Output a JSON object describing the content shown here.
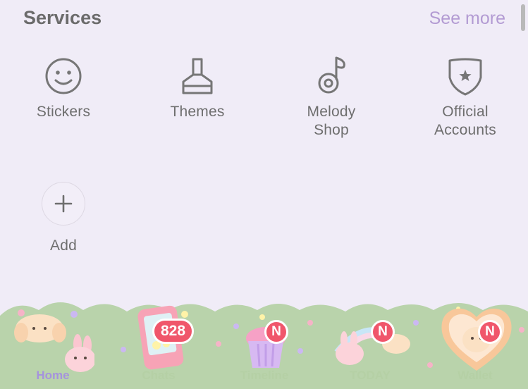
{
  "header": {
    "title": "Services",
    "see_more": "See more"
  },
  "services": [
    {
      "label": "Stickers",
      "icon": "smiley-icon"
    },
    {
      "label": "Themes",
      "icon": "paintbrush-icon"
    },
    {
      "label": "Melody\nShop",
      "icon": "music-note-icon"
    },
    {
      "label": "Official\nAccounts",
      "icon": "shield-star-icon"
    },
    {
      "label": "Add",
      "icon": "plus-icon"
    }
  ],
  "tabs": [
    {
      "label": "Home",
      "active": true
    },
    {
      "label": "Chats",
      "badge": "828"
    },
    {
      "label": "Timeline",
      "badge": "N"
    },
    {
      "label": "TODAY",
      "badge": "N"
    },
    {
      "label": "Wallet",
      "badge": "N"
    }
  ],
  "colors": {
    "background": "#f0ecf7",
    "accent": "#b39bd3",
    "tabbar_green": "#b9d3ab",
    "badge": "#f0566b"
  }
}
